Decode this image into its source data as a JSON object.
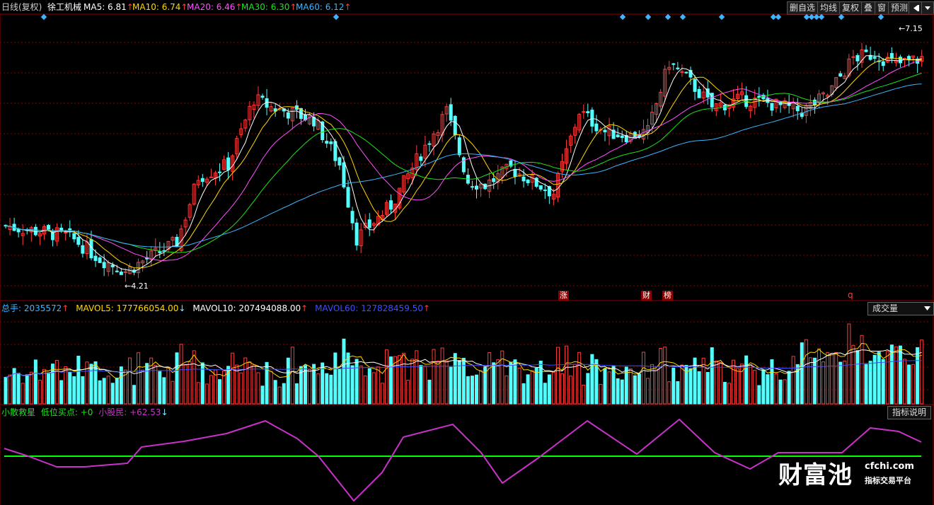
{
  "header": {
    "period": "日线(复权)",
    "stock_name": "徐工机械",
    "ma": [
      {
        "label": "MA5: 6.81",
        "arrow": "↑",
        "color": "#ffffff"
      },
      {
        "label": "MA10: 6.74",
        "arrow": "↑",
        "color": "#ffd800"
      },
      {
        "label": "MA20: 6.46",
        "arrow": "↑",
        "color": "#ff50ff"
      },
      {
        "label": "MA30: 6.30",
        "arrow": "↑",
        "color": "#19e619"
      },
      {
        "label": "MA60: 6.12",
        "arrow": "↑",
        "color": "#3cb4ff"
      }
    ]
  },
  "toolbar": {
    "del_watch": "删自选",
    "ma_line": "均线",
    "restore_rights": "复权",
    "overlay": "叠",
    "window": "窗",
    "warning": "预测",
    "nav_icon": "arrow-left-bar-icon",
    "menu_icon": "chevron-down-icon"
  },
  "price_chart": {
    "high_label": "7.15",
    "low_label": "4.21",
    "markers": [
      "涨",
      "财",
      "榜",
      "q"
    ],
    "diamond_icon": "diamond-icon"
  },
  "volume_panel": {
    "total": "总手: 2035572",
    "total_arrow": "↑",
    "mavol5": "MAVOL5: 177766054.00",
    "mavol5_arrow": "↓",
    "mavol10": "MAVOL10: 207494088.00",
    "mavol10_arrow": "↑",
    "mavol60": "MAVOL60: 127828459.50",
    "mavol60_arrow": "↑",
    "dropdown": "成交量"
  },
  "indicator_panel": {
    "name": "小散救星",
    "buy_point": "低位买点: +0",
    "retail": "小股民: +62.53",
    "retail_arrow": "↓",
    "explain_button": "指标说明"
  },
  "watermark": {
    "brand": "财富池",
    "domain": "cfchi.com",
    "tagline": "指标交易平台"
  },
  "colors": {
    "up": "#ff3c3c",
    "down": "#54ffff",
    "grid": "#8b0000",
    "ma5": "#ffffff",
    "ma10": "#ffd800",
    "ma20": "#ff50ff",
    "ma30": "#19e619",
    "ma60": "#3cb4ff",
    "indicator_line": "#c832c8",
    "indicator_base": "#00ff00",
    "mavol60": "#3c50ff"
  }
}
